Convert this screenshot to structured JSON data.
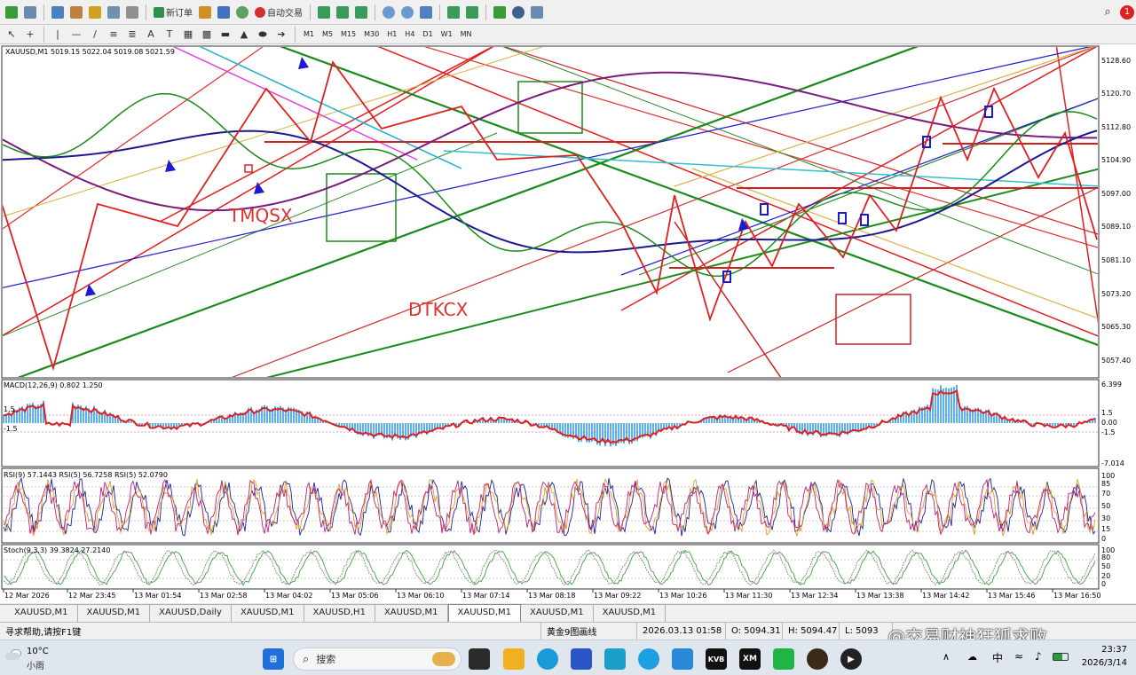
{
  "toolbar1": {
    "new_order": "新订单",
    "auto_trade": "自动交易"
  },
  "timeframes": [
    "M1",
    "M5",
    "M15",
    "M30",
    "H1",
    "H4",
    "D1",
    "W1",
    "MN"
  ],
  "chart": {
    "header": "XAUUSD,M1  5019.15 5022.04 5019.08 5021.59",
    "label_tmqsx": "TMQSX",
    "label_dtkcx": "DTKCX",
    "price_labels": [
      "5128.60",
      "5120.70",
      "5112.80",
      "5104.90",
      "5097.00",
      "5089.10",
      "5081.10",
      "5073.20",
      "5065.30",
      "5057.40"
    ],
    "macd_header": "MACD(12,26,9) 0.802 1.250",
    "macd_labels": [
      "6.399",
      "1.5",
      "0.00",
      "-1.5",
      "-7.014"
    ],
    "macd_left_labels": [
      "1.5",
      "-1.5"
    ],
    "rsi_header": "RSI(9) 57.1443  RSI(5) 56.7258  RSI(5) 52.0790",
    "rsi_labels": [
      "100",
      "85",
      "70",
      "50",
      "30",
      "15",
      "0"
    ],
    "stoch_header": "Stoch(9,3,3) 39.3824 27.2140",
    "stoch_labels": [
      "100",
      "80",
      "50",
      "20",
      "0"
    ],
    "time_labels": [
      "12 Mar 2026",
      "12 Mar 23:45",
      "13 Mar 01:54",
      "13 Mar 02:58",
      "13 Mar 04:02",
      "13 Mar 05:06",
      "13 Mar 06:10",
      "13 Mar 07:14",
      "13 Mar 08:18",
      "13 Mar 09:22",
      "13 Mar 10:26",
      "13 Mar 11:30",
      "13 Mar 12:34",
      "13 Mar 13:38",
      "13 Mar 14:42",
      "13 Mar 15:46",
      "13 Mar 16:50"
    ]
  },
  "tabs": [
    "XAUUSD,M1",
    "XAUUSD,M1",
    "XAUUSD,Daily",
    "XAUUSD,M1",
    "XAUUSD,H1",
    "XAUUSD,M1",
    "XAUUSD,M1",
    "XAUUSD,M1",
    "XAUUSD,M1"
  ],
  "active_tab": 6,
  "status": {
    "help": "寻求帮助,请按F1键",
    "profile": "黄金9图画线",
    "datetime": "2026.03.13 01:58",
    "open": "O: 5094.31",
    "high": "H: 5094.47",
    "low": "L: 5093"
  },
  "watermark": "@交易财神狂狐求败",
  "taskbar": {
    "weather_temp": "10°C",
    "weather_desc": "小雨",
    "search_placeholder": "搜索",
    "tray_lang": "中",
    "time": "23:37",
    "date": "2026/3/14",
    "kvb": "KVB",
    "xm": "XM"
  }
}
